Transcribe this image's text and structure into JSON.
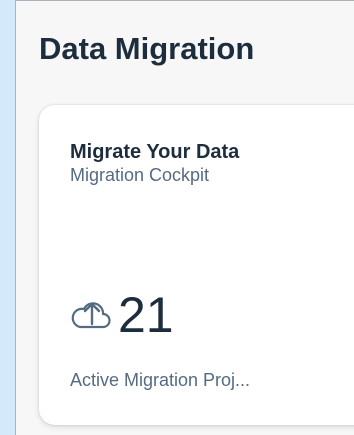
{
  "section": {
    "title": "Data Migration"
  },
  "tile": {
    "title": "Migrate Your Data",
    "subtitle": "Migration Cockpit",
    "icon": "cloud-upload-icon",
    "kpi_value": "21",
    "footer": "Active Migration Proj..."
  }
}
